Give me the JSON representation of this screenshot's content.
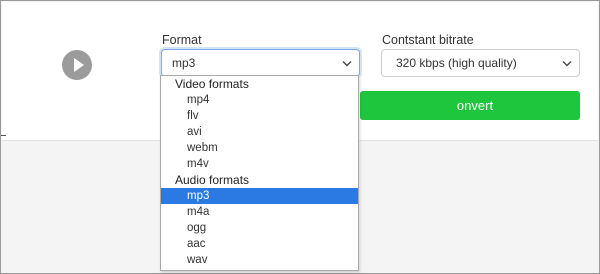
{
  "format": {
    "label": "Format",
    "selected": "mp3",
    "groups": [
      {
        "label": "Video formats",
        "options": [
          "mp4",
          "flv",
          "avi",
          "webm",
          "m4v"
        ]
      },
      {
        "label": "Audio formats",
        "options": [
          "mp3",
          "m4a",
          "ogg",
          "aac",
          "wav"
        ]
      }
    ]
  },
  "bitrate": {
    "label": "Contstant bitrate",
    "selected": "320 kbps (high quality)"
  },
  "convert_button": {
    "label": "onvert",
    "color": "#1ec63e"
  },
  "play_icon": "play-icon",
  "colors": {
    "selected_option": "#2b7ae3",
    "focus_border": "#80a8e8"
  }
}
